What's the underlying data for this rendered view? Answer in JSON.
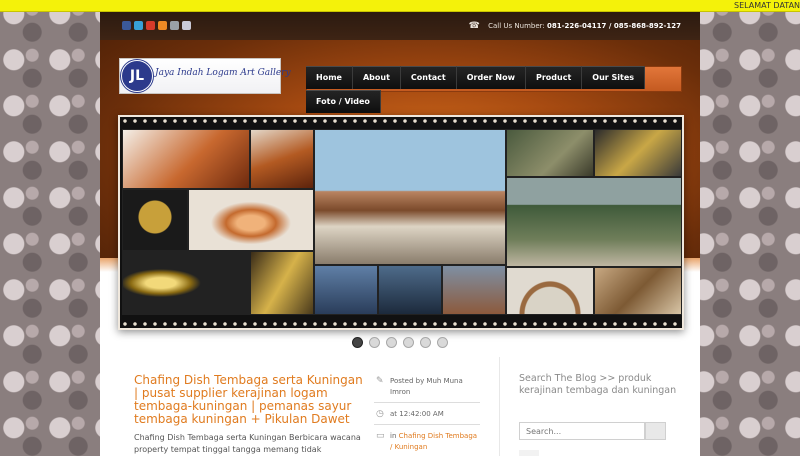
{
  "marquee": {
    "text": "SELAMAT DATAN"
  },
  "topbar": {
    "phone_label": "Call Us Number:",
    "phone_numbers": "081-226-04117 / 085-868-892-127",
    "social_icons": [
      "facebook-icon",
      "twitter-icon",
      "youtube-icon",
      "rss-icon",
      "camera-icon",
      "flickr-icon"
    ]
  },
  "logo": {
    "mark": "JL",
    "text": "Jaya Indah Logam Art Gallery"
  },
  "nav": {
    "row1": [
      "Home",
      "About",
      "Contact",
      "Order Now",
      "Product",
      "Our Sites"
    ],
    "row2": [
      "Foto / Video"
    ]
  },
  "slider": {
    "slides": 6,
    "active_slide": 1
  },
  "post": {
    "title": "Chafing Dish Tembaga serta Kuningan | pusat supplier kerajinan logam tembaga-kuningan | pemanas sayur tembaga kuningan + Pikulan Dawet",
    "excerpt": "Chafing Dish Tembaga serta Kuningan            Berbicara wacana property tempat tinggal    tangga memang tidak",
    "meta": {
      "posted_by": "Posted by Muh Muna Imron",
      "time": "at 12:42:00 AM",
      "in_label": "in",
      "category": "Chafing Dish Tembaga / Kuningan"
    }
  },
  "sidebar": {
    "search_title": "Search The Blog >> produk kerajinan tembaga dan kuningan",
    "search_placeholder": "Search..."
  },
  "colors": {
    "accent": "#e07b1f",
    "nav_bg": "#111111",
    "marquee_bg": "#f4f20a"
  }
}
